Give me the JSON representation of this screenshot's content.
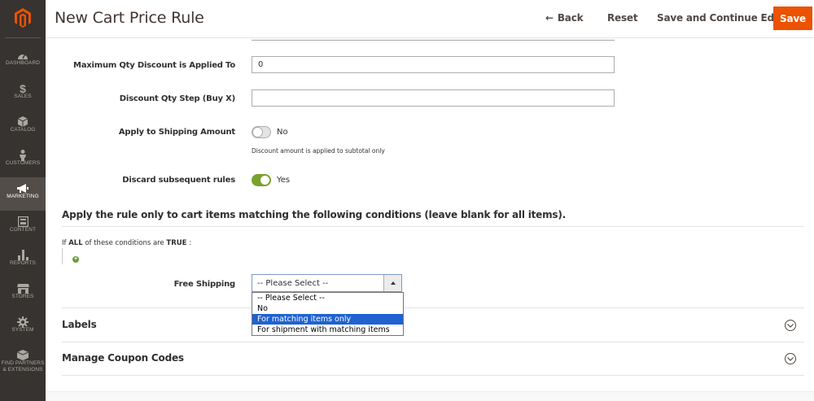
{
  "header": {
    "title": "New Cart Price Rule",
    "back_label": "Back",
    "back_icon": "arrow-left-icon",
    "reset_label": "Reset",
    "save_continue_label": "Save and Continue Edit",
    "save_label": "Save"
  },
  "colors": {
    "sidebar_bg": "#373330",
    "sidebar_active_bg": "#524d49",
    "logo_orange": "#eb5202",
    "save_button": "#eb5202",
    "toggle_on": "#79a22e",
    "dropdown_selected": "#1f62d0"
  },
  "sidebar": {
    "items": [
      {
        "label": "DASHBOARD",
        "icon": "speedometer-icon"
      },
      {
        "label": "SALES",
        "icon": "dollar-icon"
      },
      {
        "label": "CATALOG",
        "icon": "box-icon"
      },
      {
        "label": "CUSTOMERS",
        "icon": "person-icon"
      },
      {
        "label": "MARKETING",
        "icon": "megaphone-icon",
        "active": true
      },
      {
        "label": "CONTENT",
        "icon": "layout-icon"
      },
      {
        "label": "REPORTS",
        "icon": "bar-chart-icon"
      },
      {
        "label": "STORES",
        "icon": "storefront-icon"
      },
      {
        "label": "SYSTEM",
        "icon": "gear-icon"
      },
      {
        "label": "FIND PARTNERS",
        "label2": "& EXTENSIONS",
        "icon": "puzzle-box-icon"
      }
    ]
  },
  "form": {
    "max_qty_label": "Maximum Qty Discount is Applied To",
    "max_qty_value": "0",
    "qty_step_label": "Discount Qty Step (Buy X)",
    "qty_step_value": "",
    "apply_shipping_label": "Apply to Shipping Amount",
    "apply_shipping_state": "No",
    "apply_shipping_note": "Discount amount is applied to subtotal only",
    "discard_label": "Discard subsequent rules",
    "discard_state": "Yes"
  },
  "conditions": {
    "section_title": "Apply the rule only to cart items matching the following conditions (leave blank for all items).",
    "prefix": "If",
    "aggregator": "ALL",
    "middle": "of these conditions are",
    "value": "TRUE",
    "suffix": ":",
    "add_icon": "plus-circle-icon"
  },
  "free_shipping": {
    "label": "Free Shipping",
    "selected": "-- Please Select --",
    "options": [
      "-- Please Select --",
      "No",
      "For matching items only",
      "For shipment with matching items"
    ],
    "highlighted_index": 2
  },
  "sections": {
    "labels_title": "Labels",
    "coupon_title": "Manage Coupon Codes",
    "chevron_icon": "chevron-down-circle-icon"
  }
}
